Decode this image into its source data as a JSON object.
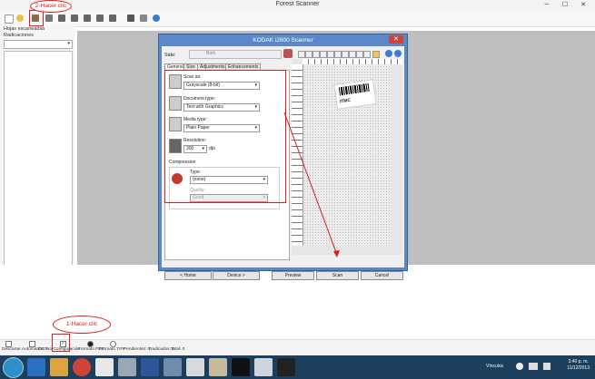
{
  "window": {
    "title": "Forest Scanner",
    "controls": [
      "─",
      "☐",
      "✕"
    ]
  },
  "left_panel": {
    "label1": "Hojas escaneadas",
    "label2": "Radicaciones"
  },
  "status_bar": {
    "text1": "Descartar Automatico",
    "text2": "OCR",
    "text3": "No Configuración",
    "text4": "Formato PDF",
    "text5": "Formato TIFF",
    "text6": "Pendientes: 0",
    "text7": "Radicados: 0",
    "text8": "Total: 0"
  },
  "scanner_dialog": {
    "title": "KODAK i2800 Scanner",
    "close": "✕",
    "side_label": "Side:",
    "side_value": "Both",
    "tabs": [
      "General",
      "Size",
      "Adjustments",
      "Enhancements"
    ],
    "scan_as_label": "Scan as:",
    "scan_as_value": "Grayscale (8-bit)",
    "document_type_label": "Document type:",
    "document_type_value": "Text with Graphics",
    "media_type_label": "Media type:",
    "media_type_value": "Plain Paper",
    "resolution_label": "Resolution:",
    "resolution_value": "300",
    "resolution_unit": "dpi",
    "compression_label": "Compression",
    "type_label": "Type:",
    "type_value": "(none)",
    "quality_label": "Quality:",
    "quality_value": "Good",
    "barcode_text": "ITMC",
    "buttons": {
      "home": "< Home",
      "device": "Device >",
      "preview": "Preview",
      "scan": "Scan",
      "cancel": "Cancel"
    }
  },
  "annotations": {
    "callout1": "1-Hacer clic",
    "callout2": "2-Hacer clic"
  },
  "taskbar": {
    "tray_label": "Vínculos",
    "time": "3:40 p. m.",
    "date": "11/12/2013"
  },
  "colors": {
    "annotation_red": "#e01b1b",
    "dialog_title_blue": "#5b88c9",
    "taskbar": "#1c3f5e"
  }
}
